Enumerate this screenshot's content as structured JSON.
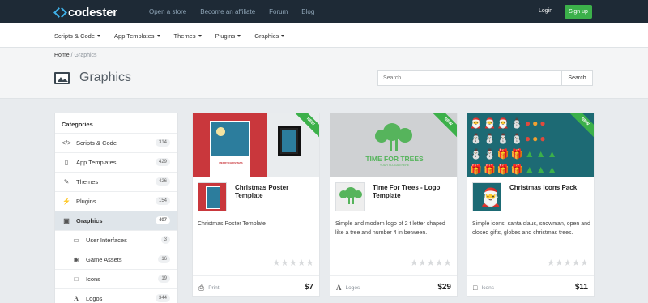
{
  "brand": {
    "name": "codester"
  },
  "topnav": {
    "open_store": "Open a store",
    "affiliate": "Become an affiliate",
    "forum": "Forum",
    "blog": "Blog"
  },
  "auth": {
    "login": "Login",
    "signup": "Sign up"
  },
  "categories_nav": [
    "Scripts & Code",
    "App Templates",
    "Themes",
    "Plugins",
    "Graphics"
  ],
  "breadcrumb": {
    "home": "Home",
    "separator": "/",
    "current": "Graphics"
  },
  "page": {
    "title": "Graphics"
  },
  "search": {
    "placeholder": "Search...",
    "button": "Search"
  },
  "sidebar": {
    "heading": "Categories",
    "items": [
      {
        "label": "Scripts & Code",
        "count": "314",
        "icon": "code-icon"
      },
      {
        "label": "App Templates",
        "count": "429",
        "icon": "mobile-icon"
      },
      {
        "label": "Themes",
        "count": "426",
        "icon": "brush-icon"
      },
      {
        "label": "Plugins",
        "count": "154",
        "icon": "plug-icon"
      },
      {
        "label": "Graphics",
        "count": "407",
        "icon": "image-icon",
        "active": true
      },
      {
        "label": "User Interfaces",
        "count": "3",
        "icon": "monitor-icon"
      },
      {
        "label": "Game Assets",
        "count": "16",
        "icon": "gamepad-icon"
      },
      {
        "label": "Icons",
        "count": "19",
        "icon": "square-icon"
      },
      {
        "label": "Logos",
        "count": "344",
        "icon": "letter-a-icon"
      }
    ]
  },
  "products": [
    {
      "badge": "NEW",
      "title": "Christmas Poster Template",
      "description": "Christmas Poster Template",
      "category": "Print",
      "category_icon": "printer-icon",
      "price": "$7",
      "rating": 0,
      "thumb_text": "MERRY CHRISTMAS"
    },
    {
      "badge": "NEW",
      "title": "Time For Trees - Logo Template",
      "description": "Simple and modern logo of 2 t letter shaped like a tree and number 4 in between.",
      "category": "Logos",
      "category_icon": "letter-a-icon",
      "price": "$29",
      "rating": 0,
      "thumb_text": "TIME FOR TREES",
      "thumb_subtext": "YOUR SLOGAN HERE"
    },
    {
      "badge": "NEW",
      "title": "Christmas Icons Pack",
      "description": "Simple icons: santa claus, snowman, open and closed gifts, globes and christmas trees.",
      "category": "Icons",
      "category_icon": "square-icon",
      "price": "$11",
      "rating": 0
    }
  ],
  "colors": {
    "topbar": "#1e2a36",
    "accent_green": "#3cb04a",
    "logo_blue": "#3fb0e8"
  }
}
